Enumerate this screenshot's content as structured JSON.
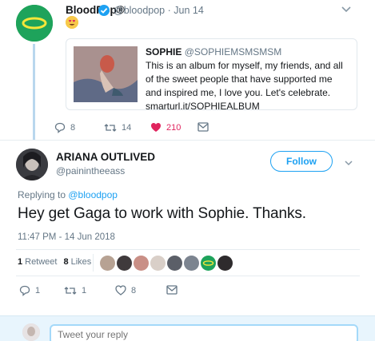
{
  "parent_tweet": {
    "name": "BloodPop®",
    "handle": "@bloodpop · Jun 14",
    "quote": {
      "name": "SOPHIE",
      "handle": "@SOPHIEMSMSMSM",
      "text": "This is an album for myself, my friends, and all of the sweet people that have supported me and inspired me, I love you. Let's celebrate. smarturl.it/SOPHIEALBUM"
    },
    "actions": {
      "replies": "8",
      "retweets": "14",
      "likes": "210"
    }
  },
  "main_tweet": {
    "name": "ARIANA OUTLIVED",
    "handle": "@painintheeass",
    "follow_label": "Follow",
    "replying_prefix": "Replying to ",
    "replying_to": "@bloodpop",
    "text": "Hey get Gaga to work with Sophie. Thanks.",
    "timestamp": "11:47 PM - 14 Jun 2018",
    "stats": {
      "retweets_count": "1",
      "retweets_label": "Retweet",
      "likes_count": "8",
      "likes_label": "Likes"
    },
    "actions": {
      "replies": "1",
      "retweets": "1",
      "likes": "8"
    }
  },
  "reply_box": {
    "placeholder": "Tweet your reply"
  },
  "colors": {
    "accent": "#1da1f2",
    "like_red": "#e0245e",
    "muted": "#657786"
  },
  "icons": [
    "halo-avatar-icon",
    "verified-icon",
    "heart-eyes-emoji",
    "reply-icon",
    "retweet-icon",
    "heart-icon",
    "message-icon",
    "chevron-down-icon"
  ]
}
